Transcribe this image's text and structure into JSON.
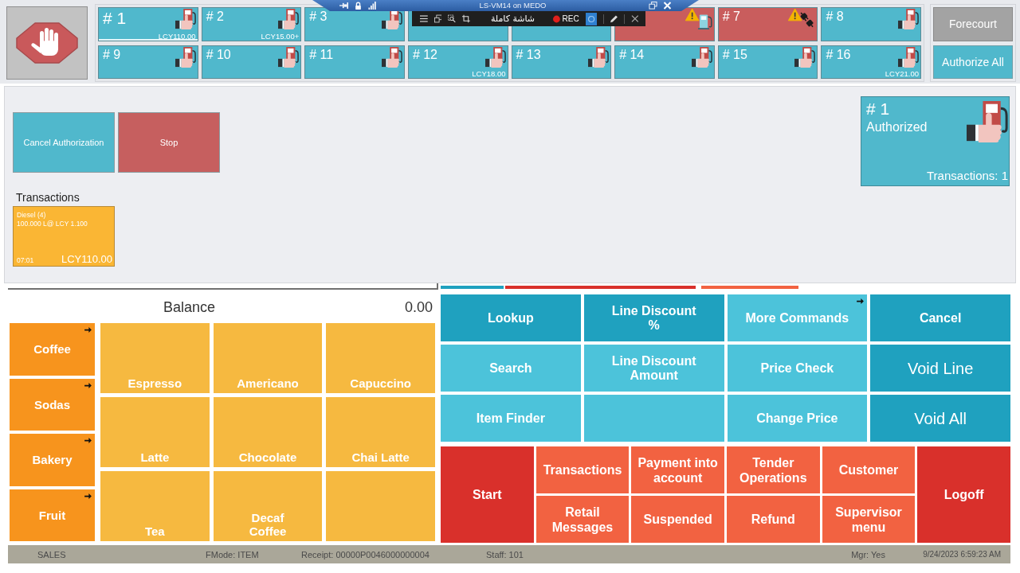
{
  "remote_bar": {
    "title": "LS-VM14 on MEDO"
  },
  "recorder": {
    "mode_label": "شاشة كاملة",
    "record_label": "REC"
  },
  "pumps": [
    {
      "label": "# 1",
      "selected": true,
      "color": "#50b8cc",
      "kind": "authorized",
      "amount": "LCY110.00"
    },
    {
      "label": "# 2",
      "selected": false,
      "color": "#50b8cc",
      "kind": "authorized",
      "amount": "LCY15.00+"
    },
    {
      "label": "# 3",
      "selected": false,
      "color": "#50b8cc",
      "kind": "authorized"
    },
    {
      "selected": false,
      "color": "#50b8cc"
    },
    {
      "selected": false,
      "color": "#50b8cc"
    },
    {
      "selected": false,
      "color": "#c95d5d",
      "kind": "alert"
    },
    {
      "label": "# 7",
      "selected": false,
      "color": "#c95d5d",
      "kind": "offline"
    },
    {
      "label": "# 8",
      "selected": false,
      "color": "#50b8cc",
      "kind": "authorized"
    },
    {
      "label": "# 9",
      "selected": false,
      "color": "#50b8cc",
      "kind": "authorized"
    },
    {
      "label": "# 10",
      "selected": false,
      "color": "#50b8cc",
      "kind": "authorized"
    },
    {
      "label": "# 11",
      "selected": false,
      "color": "#50b8cc",
      "kind": "authorized"
    },
    {
      "label": "# 12",
      "selected": false,
      "color": "#50b8cc",
      "kind": "authorized",
      "amount": "LCY18.00"
    },
    {
      "label": "# 13",
      "selected": false,
      "color": "#50b8cc",
      "kind": "authorized"
    },
    {
      "label": "# 14",
      "selected": false,
      "color": "#50b8cc",
      "kind": "authorized"
    },
    {
      "label": "# 15",
      "selected": false,
      "color": "#50b8cc",
      "kind": "authorized"
    },
    {
      "label": "# 16",
      "selected": false,
      "color": "#50b8cc",
      "kind": "authorized",
      "amount": "LCY21.00"
    }
  ],
  "forecourt_buttons": [
    {
      "label": "Forecourt",
      "disabled": true
    },
    {
      "label": "Authorize All",
      "disabled": false
    }
  ],
  "pump_actions": [
    {
      "label": "Cancel Authorization",
      "color": "#50b8cc"
    },
    {
      "label": "Stop",
      "color": "#c65f5f"
    }
  ],
  "transactions": {
    "title": "Transactions",
    "items": [
      {
        "product": "Diesel (4)",
        "detail": "100.000 L@ LCY 1.100",
        "time": "07:01",
        "amount": "LCY110.00"
      }
    ]
  },
  "pump_detail": {
    "label": "# 1",
    "status": "Authorized",
    "kind": "authorized",
    "transactions": "Transactions: 1"
  },
  "balance": {
    "label": "Balance",
    "value": "0.00"
  },
  "categories": [
    {
      "label": "Coffee",
      "submenu": true
    },
    {
      "label": "Sodas",
      "submenu": true
    },
    {
      "label": "Bakery",
      "submenu": true
    },
    {
      "label": "Fruit",
      "submenu": true
    }
  ],
  "items": [
    {
      "kind": "product",
      "label": "Espresso"
    },
    {
      "kind": "product",
      "label": "Americano"
    },
    {
      "kind": "product",
      "label": "Capuccino"
    },
    {
      "kind": "product",
      "label": "Latte"
    },
    {
      "kind": "product",
      "label": "Chocolate"
    },
    {
      "kind": "product",
      "label": "Chai Latte"
    },
    {
      "kind": "product",
      "label": "Tea"
    },
    {
      "kind": "product",
      "label": "Decaf Coffee"
    },
    {
      "kind": "blank"
    }
  ],
  "commands": [
    {
      "label": "Lookup",
      "color": "#1fa1bf",
      "kind": "standard",
      "submenu": false
    },
    {
      "label": "Line Discount\n%",
      "color": "#1fa1bf",
      "kind": "standard",
      "submenu": false
    },
    {
      "label": "More Commands",
      "color": "#4cc3da",
      "kind": "standard",
      "submenu": true
    },
    {
      "label": "Cancel",
      "color": "#1fa1bf",
      "kind": "standard",
      "submenu": false
    },
    {
      "label": "Search",
      "color": "#4cc3da",
      "kind": "standard",
      "submenu": false
    },
    {
      "label": "Line Discount Amount",
      "color": "#4cc3da",
      "kind": "standard",
      "submenu": false
    },
    {
      "label": "Price Check",
      "color": "#4cc3da",
      "kind": "standard",
      "submenu": false
    },
    {
      "label": "Void Line",
      "color": "#1fa1bf",
      "kind": "major",
      "submenu": false
    },
    {
      "label": "Item Finder",
      "color": "#4cc3da",
      "kind": "standard",
      "submenu": false
    },
    {
      "color": "#4cc3da",
      "kind": "standard",
      "submenu": false
    },
    {
      "label": "Change Price",
      "color": "#4cc3da",
      "kind": "standard",
      "submenu": false
    },
    {
      "label": "Void All",
      "color": "#1fa1bf",
      "kind": "major",
      "submenu": false
    }
  ],
  "actions": [
    {
      "label": "Start",
      "color": "#d9302b",
      "kind": "tall"
    },
    {
      "label": "Transactions",
      "color": "#f26241",
      "kind": "standard"
    },
    {
      "label": "Payment into account",
      "color": "#f26241",
      "kind": "standard"
    },
    {
      "label": "Tender Operations",
      "color": "#f26241",
      "kind": "standard"
    },
    {
      "label": "Customer",
      "color": "#f26241",
      "kind": "standard"
    },
    {
      "label": "Logoff",
      "color": "#d9302b",
      "kind": "tall"
    },
    {
      "label": "Retail Messages",
      "color": "#f26241",
      "kind": "standard"
    },
    {
      "label": "Suspended",
      "color": "#f26241",
      "kind": "standard"
    },
    {
      "label": "Refund",
      "color": "#f26241",
      "kind": "standard"
    },
    {
      "label": "Supervisor menu",
      "color": "#f26241",
      "kind": "standard"
    }
  ],
  "status_bar": {
    "mode": "SALES",
    "fmode": "FMode: ITEM",
    "receipt": "Receipt: 00000P0046000000004",
    "staff": "Staff: 101",
    "manager": "Mgr: Yes",
    "datetime": "9/24/2023 6:59:23 AM"
  }
}
